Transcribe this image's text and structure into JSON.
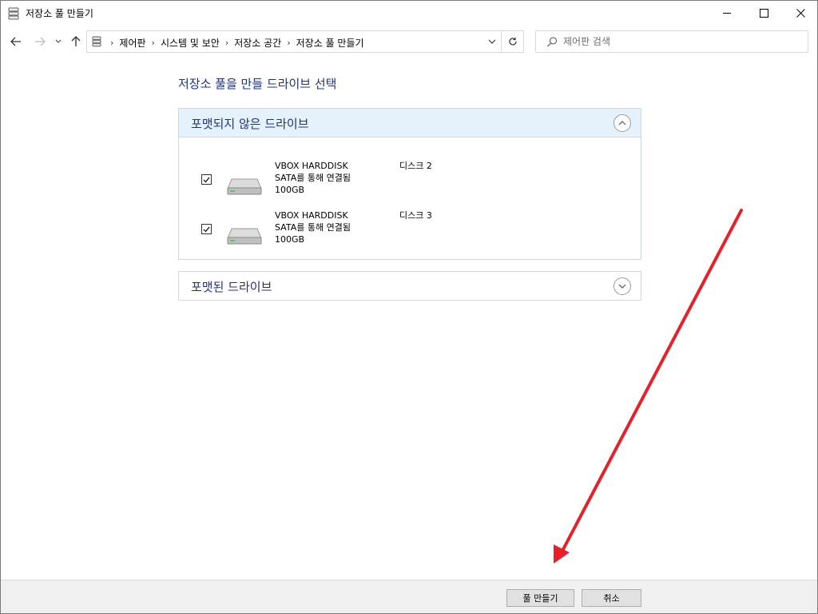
{
  "window": {
    "title": "저장소 풀 만들기"
  },
  "addressbar": {
    "crumbs": [
      "제어판",
      "시스템 및 보안",
      "저장소 공간",
      "저장소 풀 만들기"
    ]
  },
  "search": {
    "placeholder": "제어판 검색"
  },
  "main": {
    "heading": "저장소 풀을 만들 드라이브 선택",
    "unformatted_section": {
      "title": "포맷되지 않은 드라이브",
      "expanded": true,
      "drives": [
        {
          "name": "VBOX HARDDISK",
          "connection": "SATA를 통해 연결됨",
          "size": "100GB",
          "disk": "디스크 2",
          "checked": true
        },
        {
          "name": "VBOX HARDDISK",
          "connection": "SATA를 통해 연결됨",
          "size": "100GB",
          "disk": "디스크 3",
          "checked": true
        }
      ]
    },
    "formatted_section": {
      "title": "포맷된 드라이브",
      "expanded": false
    }
  },
  "footer": {
    "create_label": "풀 만들기",
    "cancel_label": "취소"
  },
  "annotation": {
    "arrow_color": "#e8202a"
  },
  "colors": {
    "heading": "#1e3287",
    "section_header_bg": "#e5f1fb",
    "footer_bg": "#f0f0f0"
  }
}
